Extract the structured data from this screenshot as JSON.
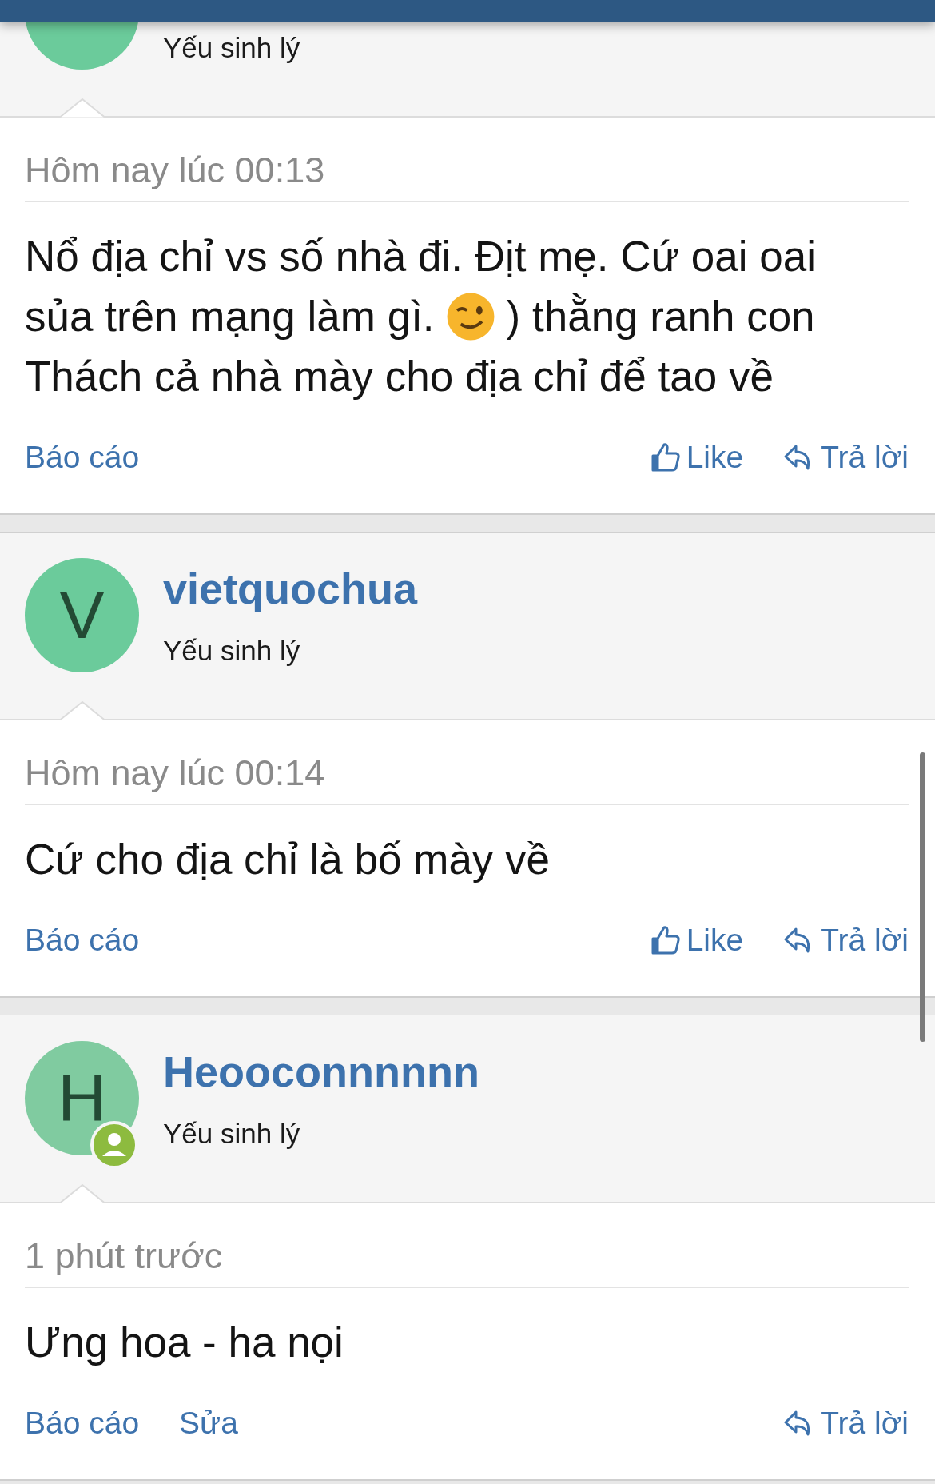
{
  "posts": [
    {
      "avatar": {
        "color": "#6bcb9b",
        "online": false
      },
      "title": "Yếu sinh lý",
      "time": "Hôm nay lúc 00:13",
      "body": [
        [
          {
            "kind": "text",
            "text": "Nổ địa chỉ vs số nhà đi. Địt mẹ. Cứ oai oai"
          }
        ],
        [
          {
            "kind": "text",
            "text": "sủa trên mạng làm gì."
          },
          {
            "kind": "emoji"
          },
          {
            "kind": "text",
            "text": ") thằng ranh con"
          }
        ],
        [
          {
            "kind": "text",
            "text": "Thách cả nhà mày cho địa chỉ để tao về"
          }
        ]
      ],
      "actions": [
        {
          "kind": "report",
          "label": "Báo cáo"
        },
        {
          "kind": "like",
          "label": "Like"
        },
        {
          "kind": "reply",
          "label": "Trả lời"
        }
      ]
    },
    {
      "avatar": {
        "letter": "V",
        "color": "#6bcb9b",
        "online": false
      },
      "username": "vietquochua",
      "title": "Yếu sinh lý",
      "time": "Hôm nay lúc 00:14",
      "body": [
        [
          {
            "kind": "text",
            "text": "Cứ cho địa chỉ là bố mày về"
          }
        ]
      ],
      "actions": [
        {
          "kind": "report",
          "label": "Báo cáo"
        },
        {
          "kind": "like",
          "label": "Like"
        },
        {
          "kind": "reply",
          "label": "Trả lời"
        }
      ]
    },
    {
      "avatar": {
        "letter": "H",
        "color": "#80cba0",
        "online": true
      },
      "username": "Heooconnnnnn",
      "title": "Yếu sinh lý",
      "time": "1 phút trước",
      "body": [
        [
          {
            "kind": "text",
            "text": "Ưng hoa - ha nọi"
          }
        ]
      ],
      "actions": [
        {
          "kind": "report",
          "label": "Báo cáo"
        },
        {
          "kind": "edit",
          "label": "Sửa"
        },
        {
          "kind": "reply",
          "label": "Trả lời"
        }
      ]
    }
  ]
}
